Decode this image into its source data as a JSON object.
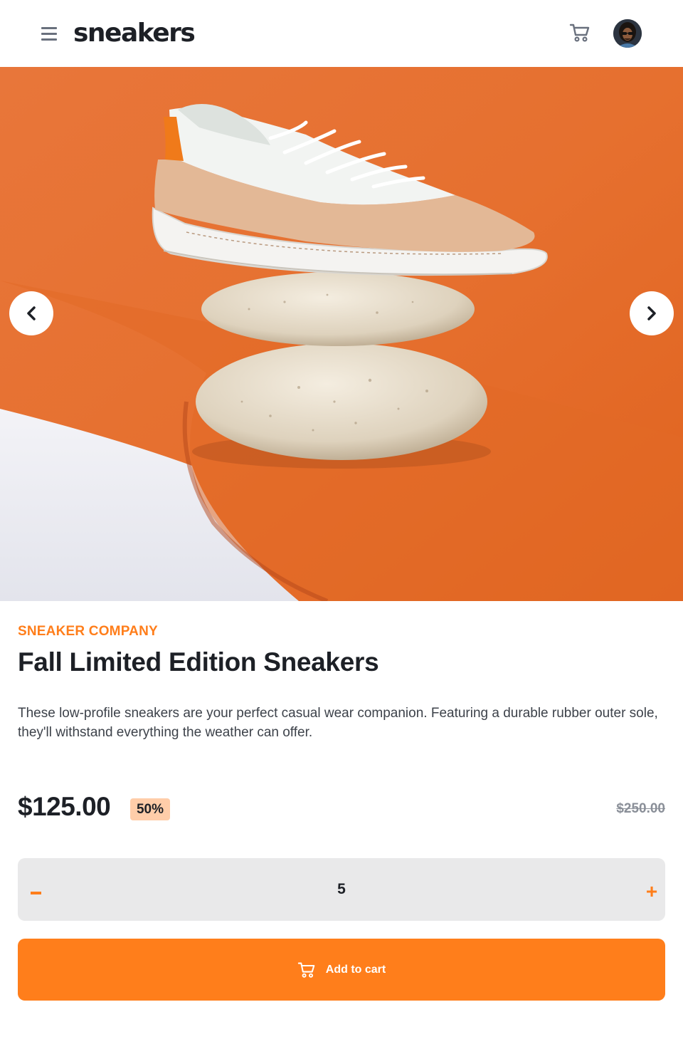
{
  "header": {
    "logo": "sneakers",
    "menu_icon": "hamburger-icon",
    "cart_icon": "cart-icon",
    "avatar": "user-avatar"
  },
  "gallery": {
    "prev_icon": "chevron-left-icon",
    "next_icon": "chevron-right-icon"
  },
  "product": {
    "company": "SNEAKER COMPANY",
    "title": "Fall Limited Edition Sneakers",
    "description": "These low-profile sneakers are your perfect casual wear companion. Featuring a durable rubber outer sole, they'll withstand everything the weather can offer.",
    "price": "$125.00",
    "discount": "50%",
    "original_price": "$250.00"
  },
  "quantity": {
    "minus_label": "",
    "value": "5",
    "plus_label": "+"
  },
  "actions": {
    "add_to_cart": "Add to cart"
  },
  "colors": {
    "accent": "#ff7e1b",
    "discount_bg": "#ffcda9",
    "dark": "#1d2026",
    "grey": "#69707d"
  }
}
